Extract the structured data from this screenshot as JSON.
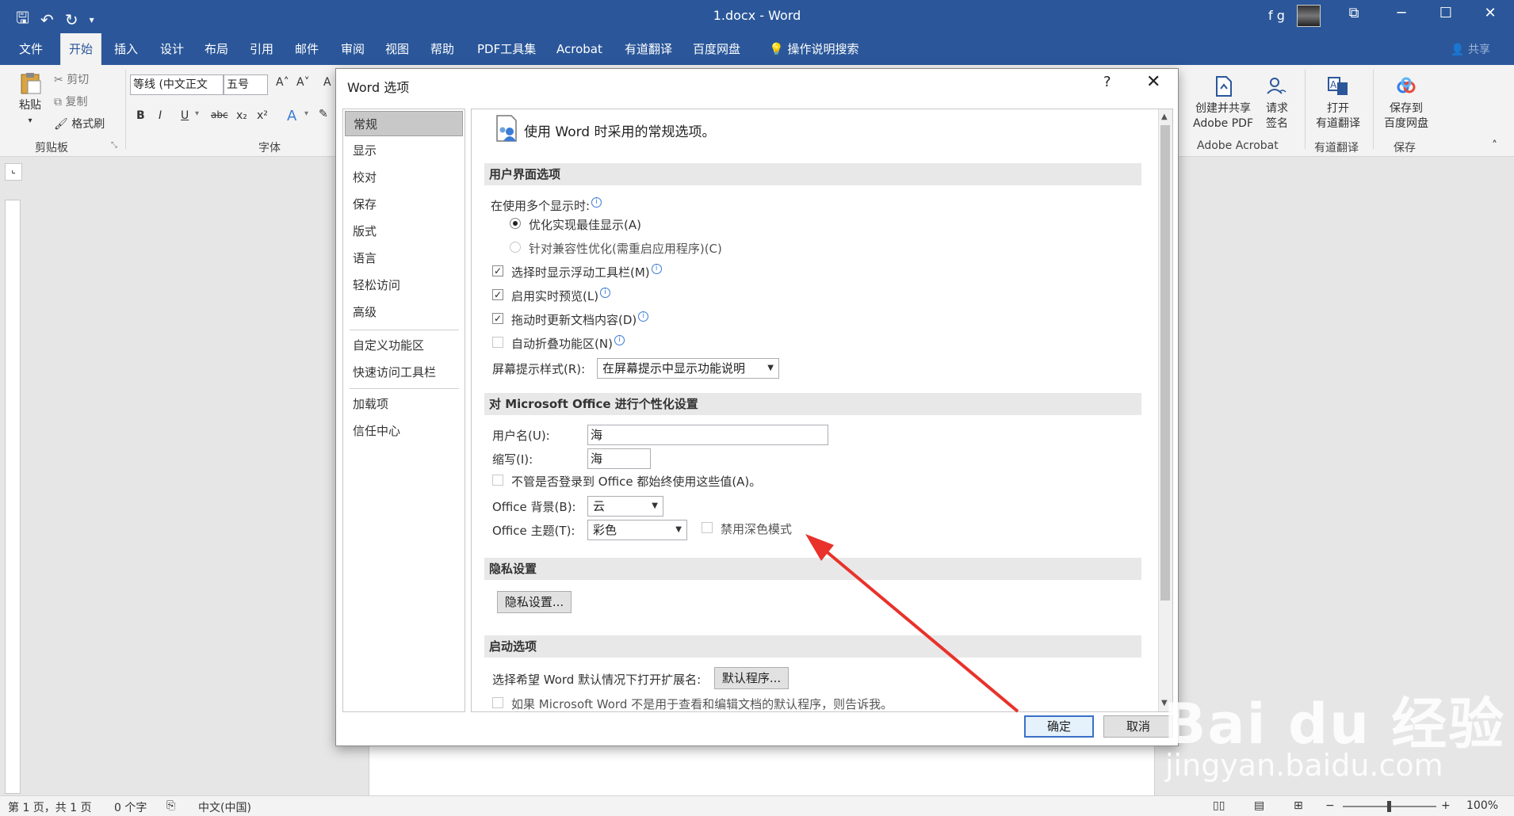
{
  "window": {
    "doc_title": "1.docx - Word",
    "user_initials": "f g",
    "share": "共享"
  },
  "tabs": [
    "文件",
    "开始",
    "插入",
    "设计",
    "布局",
    "引用",
    "邮件",
    "审阅",
    "视图",
    "帮助",
    "PDF工具集",
    "Acrobat",
    "有道翻译",
    "百度网盘"
  ],
  "tell_me": "操作说明搜索",
  "ribbon": {
    "paste": "粘贴",
    "cut": "剪切",
    "copy": "复制",
    "format_painter": "格式刷",
    "clipboard_label": "剪贴板",
    "font_name": "等线 (中文正文",
    "font_size": "五号",
    "font_label": "字体",
    "create_pdf_line1": "创建并共享",
    "create_pdf_line2": "Adobe PDF",
    "request_sign_line1": "请求",
    "request_sign_line2": "签名",
    "acrobat_label": "Adobe Acrobat",
    "open_trans_line1": "打开",
    "open_trans_line2": "有道翻译",
    "youdao_label": "有道翻译",
    "save_baidu_line1": "保存到",
    "save_baidu_line2": "百度网盘",
    "save_label": "保存"
  },
  "dialog": {
    "title": "Word 选项",
    "help": "?",
    "close": "✕",
    "nav": [
      "常规",
      "显示",
      "校对",
      "保存",
      "版式",
      "语言",
      "轻松访问",
      "高级",
      "自定义功能区",
      "快速访问工具栏",
      "加载项",
      "信任中心"
    ],
    "header": "使用 Word 时采用的常规选项。",
    "sections": {
      "ui": "用户界面选项",
      "personalize": "对 Microsoft Office 进行个性化设置",
      "privacy": "隐私设置",
      "startup": "启动选项"
    },
    "multi_display_label": "在使用多个显示时:",
    "radio_best": "优化实现最佳显示(A)",
    "radio_compat": "针对兼容性优化(需重启应用程序)(C)",
    "cb_minitoolbar": "选择时显示浮动工具栏(M)",
    "cb_livepreview": "启用实时预览(L)",
    "cb_update_drag": "拖动时更新文档内容(D)",
    "cb_collapse": "自动折叠功能区(N)",
    "tooltip_label": "屏幕提示样式(R):",
    "tooltip_value": "在屏幕提示中显示功能说明",
    "username_label": "用户名(U):",
    "username_value": "海",
    "initials_label": "缩写(I):",
    "initials_value": "海",
    "cb_always_use": "不管是否登录到 Office 都始终使用这些值(A)。",
    "bg_label": "Office 背景(B):",
    "bg_value": "云",
    "theme_label": "Office 主题(T):",
    "theme_value": "彩色",
    "cb_dark": "禁用深色模式",
    "privacy_btn": "隐私设置...",
    "startup_label": "选择希望 Word 默认情况下打开扩展名:",
    "default_btn": "默认程序...",
    "cb_not_default": "如果 Microsoft Word 不是用于查看和编辑文档的默认程序，则告诉我。",
    "ok": "确定",
    "cancel": "取消"
  },
  "status": {
    "page": "第 1 页，共 1 页",
    "words": "0 个字",
    "language": "中文(中国)",
    "zoom": "100%"
  },
  "watermark": {
    "main": "Bai du 经验",
    "sub": "jingyan.baidu.com"
  },
  "colors": {
    "word_blue": "#2b579a",
    "annotation_red": "#e8322b"
  }
}
